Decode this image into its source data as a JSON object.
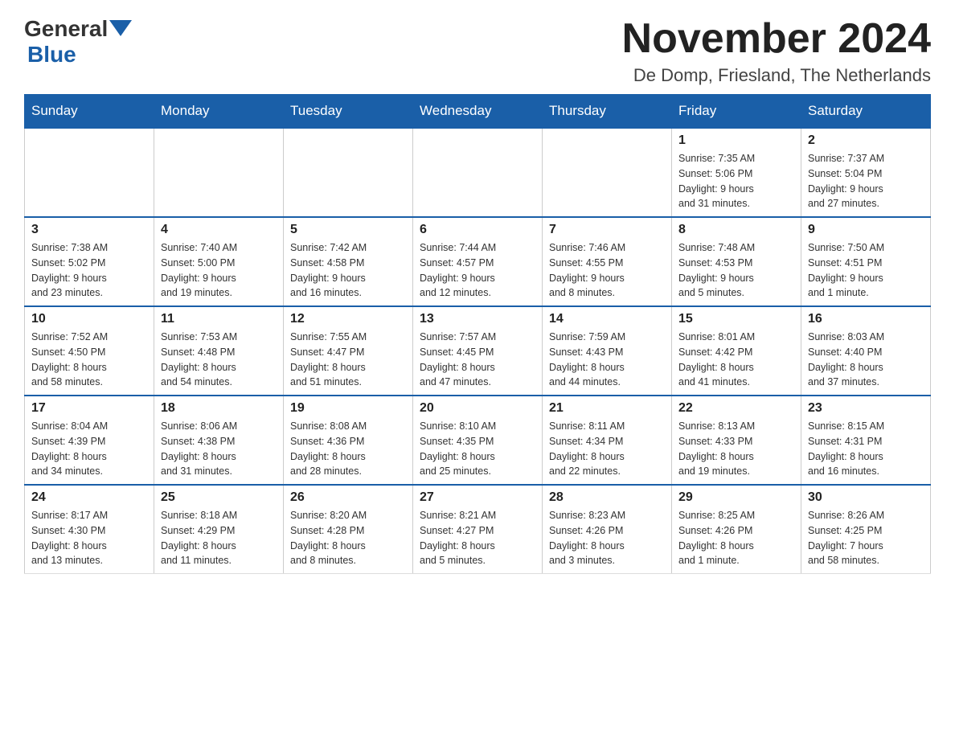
{
  "logo": {
    "general": "General",
    "blue": "Blue"
  },
  "title": "November 2024",
  "location": "De Domp, Friesland, The Netherlands",
  "days_of_week": [
    "Sunday",
    "Monday",
    "Tuesday",
    "Wednesday",
    "Thursday",
    "Friday",
    "Saturday"
  ],
  "weeks": [
    [
      {
        "day": "",
        "info": ""
      },
      {
        "day": "",
        "info": ""
      },
      {
        "day": "",
        "info": ""
      },
      {
        "day": "",
        "info": ""
      },
      {
        "day": "",
        "info": ""
      },
      {
        "day": "1",
        "info": "Sunrise: 7:35 AM\nSunset: 5:06 PM\nDaylight: 9 hours\nand 31 minutes."
      },
      {
        "day": "2",
        "info": "Sunrise: 7:37 AM\nSunset: 5:04 PM\nDaylight: 9 hours\nand 27 minutes."
      }
    ],
    [
      {
        "day": "3",
        "info": "Sunrise: 7:38 AM\nSunset: 5:02 PM\nDaylight: 9 hours\nand 23 minutes."
      },
      {
        "day": "4",
        "info": "Sunrise: 7:40 AM\nSunset: 5:00 PM\nDaylight: 9 hours\nand 19 minutes."
      },
      {
        "day": "5",
        "info": "Sunrise: 7:42 AM\nSunset: 4:58 PM\nDaylight: 9 hours\nand 16 minutes."
      },
      {
        "day": "6",
        "info": "Sunrise: 7:44 AM\nSunset: 4:57 PM\nDaylight: 9 hours\nand 12 minutes."
      },
      {
        "day": "7",
        "info": "Sunrise: 7:46 AM\nSunset: 4:55 PM\nDaylight: 9 hours\nand 8 minutes."
      },
      {
        "day": "8",
        "info": "Sunrise: 7:48 AM\nSunset: 4:53 PM\nDaylight: 9 hours\nand 5 minutes."
      },
      {
        "day": "9",
        "info": "Sunrise: 7:50 AM\nSunset: 4:51 PM\nDaylight: 9 hours\nand 1 minute."
      }
    ],
    [
      {
        "day": "10",
        "info": "Sunrise: 7:52 AM\nSunset: 4:50 PM\nDaylight: 8 hours\nand 58 minutes."
      },
      {
        "day": "11",
        "info": "Sunrise: 7:53 AM\nSunset: 4:48 PM\nDaylight: 8 hours\nand 54 minutes."
      },
      {
        "day": "12",
        "info": "Sunrise: 7:55 AM\nSunset: 4:47 PM\nDaylight: 8 hours\nand 51 minutes."
      },
      {
        "day": "13",
        "info": "Sunrise: 7:57 AM\nSunset: 4:45 PM\nDaylight: 8 hours\nand 47 minutes."
      },
      {
        "day": "14",
        "info": "Sunrise: 7:59 AM\nSunset: 4:43 PM\nDaylight: 8 hours\nand 44 minutes."
      },
      {
        "day": "15",
        "info": "Sunrise: 8:01 AM\nSunset: 4:42 PM\nDaylight: 8 hours\nand 41 minutes."
      },
      {
        "day": "16",
        "info": "Sunrise: 8:03 AM\nSunset: 4:40 PM\nDaylight: 8 hours\nand 37 minutes."
      }
    ],
    [
      {
        "day": "17",
        "info": "Sunrise: 8:04 AM\nSunset: 4:39 PM\nDaylight: 8 hours\nand 34 minutes."
      },
      {
        "day": "18",
        "info": "Sunrise: 8:06 AM\nSunset: 4:38 PM\nDaylight: 8 hours\nand 31 minutes."
      },
      {
        "day": "19",
        "info": "Sunrise: 8:08 AM\nSunset: 4:36 PM\nDaylight: 8 hours\nand 28 minutes."
      },
      {
        "day": "20",
        "info": "Sunrise: 8:10 AM\nSunset: 4:35 PM\nDaylight: 8 hours\nand 25 minutes."
      },
      {
        "day": "21",
        "info": "Sunrise: 8:11 AM\nSunset: 4:34 PM\nDaylight: 8 hours\nand 22 minutes."
      },
      {
        "day": "22",
        "info": "Sunrise: 8:13 AM\nSunset: 4:33 PM\nDaylight: 8 hours\nand 19 minutes."
      },
      {
        "day": "23",
        "info": "Sunrise: 8:15 AM\nSunset: 4:31 PM\nDaylight: 8 hours\nand 16 minutes."
      }
    ],
    [
      {
        "day": "24",
        "info": "Sunrise: 8:17 AM\nSunset: 4:30 PM\nDaylight: 8 hours\nand 13 minutes."
      },
      {
        "day": "25",
        "info": "Sunrise: 8:18 AM\nSunset: 4:29 PM\nDaylight: 8 hours\nand 11 minutes."
      },
      {
        "day": "26",
        "info": "Sunrise: 8:20 AM\nSunset: 4:28 PM\nDaylight: 8 hours\nand 8 minutes."
      },
      {
        "day": "27",
        "info": "Sunrise: 8:21 AM\nSunset: 4:27 PM\nDaylight: 8 hours\nand 5 minutes."
      },
      {
        "day": "28",
        "info": "Sunrise: 8:23 AM\nSunset: 4:26 PM\nDaylight: 8 hours\nand 3 minutes."
      },
      {
        "day": "29",
        "info": "Sunrise: 8:25 AM\nSunset: 4:26 PM\nDaylight: 8 hours\nand 1 minute."
      },
      {
        "day": "30",
        "info": "Sunrise: 8:26 AM\nSunset: 4:25 PM\nDaylight: 7 hours\nand 58 minutes."
      }
    ]
  ]
}
